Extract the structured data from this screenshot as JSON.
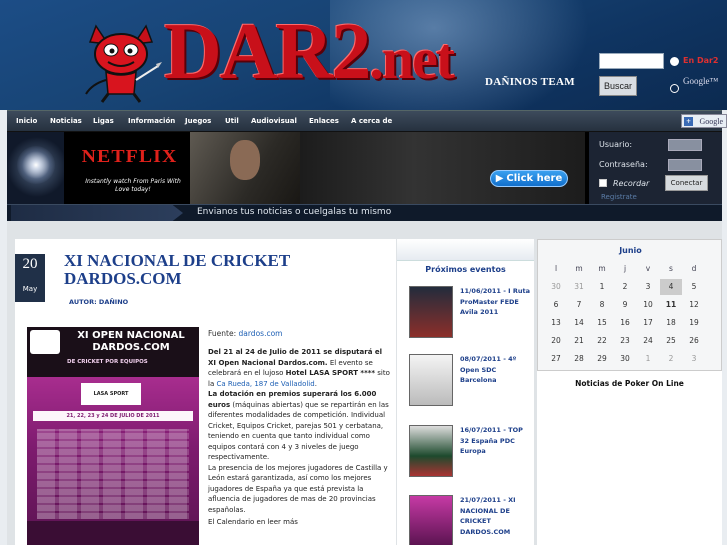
{
  "header": {
    "logo_text": "DAR2",
    "logo_suffix": ".net",
    "team": "DAÑINOS TEAM",
    "search_placeholder": "",
    "radio_label": "En Dar2",
    "search_button": "Buscar",
    "google_label": "Google™"
  },
  "nav": {
    "items": [
      "Inicio",
      "Noticias",
      "Ligas",
      "Información",
      "Juegos",
      "Util",
      "Audiovisual",
      "Enlaces",
      "A cerca de"
    ],
    "google_button": "Google"
  },
  "ad": {
    "brand": "NETFLIX",
    "tagline": "Instantly watch From Paris With Love today!",
    "click_label": "Click here"
  },
  "login": {
    "user_label": "Usuario:",
    "password_label": "Contraseña:",
    "remember_label": "Recordar",
    "submit_label": "Conectar",
    "register_label": "Registrate"
  },
  "ticker": {
    "text": "Envianos tus noticias o cuelgalas tu mismo"
  },
  "article": {
    "day": "20",
    "month": "May",
    "title": "XI NACIONAL DE CRICKET DARDOS.COM",
    "author": "AUTOR: DAÑINO",
    "source_label": "Fuente: ",
    "source_link": "dardos.com",
    "poster": {
      "title_line": "XI OPEN NACIONAL DARDOS.COM",
      "subtitle": "DE CRICKET POR EQUIPOS",
      "sponsor": "LASA SPORT",
      "dates": "21, 22, 23 y 24 DE JULIO DE 2011"
    },
    "p1_a": "Del 21 al 24 de Julio de 2011 se disputará el XI Open Nacional Dardos.com.",
    "p1_b": " El evento se celebrará en el lujoso ",
    "p1_c": "Hotel LASA SPORT ****",
    "p1_d": " sito la ",
    "p1_link": "Ca Rueda, 187 de Valladolid",
    "p1_e": ".",
    "p2_a": "La dotación en premios superará los 6.000 euros",
    "p2_b": " (máquinas abiertas) que se repartirán en las diferentes modalidades de competición. Individual Cricket, Equipos Cricket, parejas 501 y cerbatana, teniendo en cuenta que tanto individual como equipos contará con 4 y 3 niveles de juego respectivamente.",
    "p3": "La presencia de los mejores jugadores de Castilla y León estará garantizada, así como los mejores jugadores de España ya que está prevista la afluencia de jugadores de mas de 20 provincias españolas.",
    "read_more": "El Calendario en leer más"
  },
  "events": {
    "title": "Próximos eventos",
    "items": [
      "11/06/2011 - I Ruta ProMaster FEDE Avila 2011",
      "08/07/2011 - 4º Open SDC Barcelona",
      "16/07/2011 - TOP 32 España PDC Europa",
      "21/07/2011 - XI NACIONAL DE CRICKET DARDOS.COM"
    ]
  },
  "calendar": {
    "month": "Junio",
    "weekdays": [
      "l",
      "m",
      "m",
      "j",
      "v",
      "s",
      "d"
    ],
    "weeks": [
      [
        "30",
        "31",
        "1",
        "2",
        "3",
        "4",
        "5"
      ],
      [
        "6",
        "7",
        "8",
        "9",
        "10",
        "11",
        "12"
      ],
      [
        "13",
        "14",
        "15",
        "16",
        "17",
        "18",
        "19"
      ],
      [
        "20",
        "21",
        "22",
        "23",
        "24",
        "25",
        "26"
      ],
      [
        "27",
        "28",
        "29",
        "30",
        "1",
        "2",
        "3"
      ]
    ]
  },
  "poker": {
    "title": "Noticias de Poker On Line"
  },
  "colors": {
    "logo_red": "#c8101a",
    "link_blue": "#1d3f8a",
    "header_blue": "#174373",
    "nav_dark": "#26313f"
  }
}
